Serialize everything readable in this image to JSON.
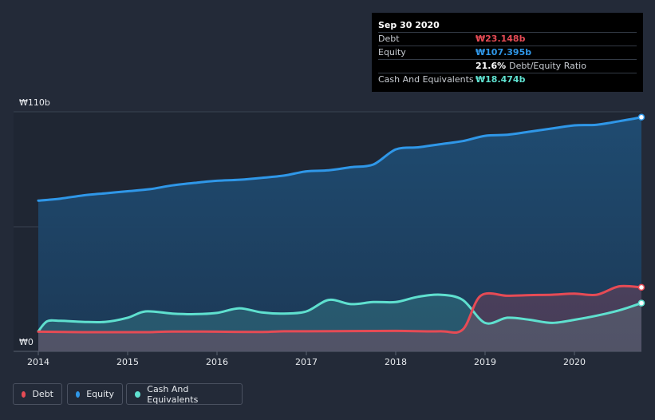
{
  "tooltip": {
    "date": "Sep 30 2020",
    "rows": [
      {
        "label": "Debt",
        "value": "₩23.148b",
        "color": "#e64b55"
      },
      {
        "label": "Equity",
        "value": "₩107.395b",
        "color": "#2f97e8"
      },
      {
        "label": "",
        "value": "21.6%",
        "sub": "Debt/Equity Ratio",
        "color": "#ffffff"
      },
      {
        "label": "Cash And Equivalents",
        "value": "₩18.474b",
        "color": "#5fe0cf"
      }
    ]
  },
  "legend": [
    {
      "label": "Debt",
      "color": "#e64b55"
    },
    {
      "label": "Equity",
      "color": "#2f97e8"
    },
    {
      "label": "Cash And Equivalents",
      "color": "#5fe0cf"
    }
  ],
  "chart_data": {
    "type": "area",
    "ylabel_top": "₩110b",
    "ylabel_bottom": "₩0",
    "ylim": [
      0,
      110
    ],
    "xlim": [
      2014.0,
      2020.75
    ],
    "x_ticks": [
      "2014",
      "2015",
      "2016",
      "2017",
      "2018",
      "2019",
      "2020"
    ],
    "series": [
      {
        "name": "Equity",
        "color": "#2f97e8",
        "points": [
          [
            2014.0,
            67.5
          ],
          [
            2014.25,
            68.5
          ],
          [
            2014.5,
            70.0
          ],
          [
            2014.75,
            71.0
          ],
          [
            2015.0,
            72.0
          ],
          [
            2015.25,
            73.0
          ],
          [
            2015.5,
            74.8
          ],
          [
            2015.75,
            76.0
          ],
          [
            2016.0,
            77.0
          ],
          [
            2016.25,
            77.5
          ],
          [
            2016.5,
            78.4
          ],
          [
            2016.75,
            79.5
          ],
          [
            2017.0,
            81.5
          ],
          [
            2017.25,
            82.0
          ],
          [
            2017.5,
            83.5
          ],
          [
            2017.75,
            84.8
          ],
          [
            2018.0,
            92.0
          ],
          [
            2018.25,
            93.0
          ],
          [
            2018.5,
            94.5
          ],
          [
            2018.75,
            96.0
          ],
          [
            2019.0,
            98.5
          ],
          [
            2019.25,
            99.0
          ],
          [
            2019.5,
            100.5
          ],
          [
            2019.75,
            102.0
          ],
          [
            2020.0,
            103.5
          ],
          [
            2020.25,
            103.8
          ],
          [
            2020.5,
            105.5
          ],
          [
            2020.75,
            107.4
          ]
        ]
      },
      {
        "name": "Cash And Equivalents",
        "color": "#5fe0cf",
        "points": [
          [
            2014.0,
            5.0
          ],
          [
            2014.1,
            9.8
          ],
          [
            2014.25,
            10.0
          ],
          [
            2014.5,
            9.5
          ],
          [
            2014.75,
            9.5
          ],
          [
            2015.0,
            11.5
          ],
          [
            2015.2,
            14.5
          ],
          [
            2015.5,
            13.5
          ],
          [
            2015.75,
            13.2
          ],
          [
            2016.0,
            13.8
          ],
          [
            2016.25,
            16.0
          ],
          [
            2016.5,
            14.0
          ],
          [
            2016.75,
            13.5
          ],
          [
            2017.0,
            14.5
          ],
          [
            2017.25,
            20.0
          ],
          [
            2017.5,
            18.0
          ],
          [
            2017.75,
            19.0
          ],
          [
            2018.0,
            19.0
          ],
          [
            2018.25,
            21.5
          ],
          [
            2018.5,
            22.5
          ],
          [
            2018.75,
            20.0
          ],
          [
            2019.0,
            9.0
          ],
          [
            2019.25,
            11.5
          ],
          [
            2019.5,
            10.5
          ],
          [
            2019.75,
            9.0
          ],
          [
            2020.0,
            10.5
          ],
          [
            2020.25,
            12.5
          ],
          [
            2020.5,
            15.0
          ],
          [
            2020.75,
            18.5
          ]
        ]
      },
      {
        "name": "Debt",
        "color": "#e64b55",
        "points": [
          [
            2014.0,
            4.8
          ],
          [
            2014.5,
            4.6
          ],
          [
            2015.0,
            4.6
          ],
          [
            2015.25,
            4.6
          ],
          [
            2015.5,
            4.9
          ],
          [
            2016.0,
            4.8
          ],
          [
            2016.5,
            4.7
          ],
          [
            2016.75,
            5.0
          ],
          [
            2017.0,
            5.0
          ],
          [
            2017.5,
            5.1
          ],
          [
            2018.0,
            5.2
          ],
          [
            2018.5,
            5.0
          ],
          [
            2018.75,
            5.8
          ],
          [
            2018.95,
            22.0
          ],
          [
            2019.25,
            22.0
          ],
          [
            2019.5,
            22.3
          ],
          [
            2019.75,
            22.5
          ],
          [
            2020.0,
            23.0
          ],
          [
            2020.25,
            22.5
          ],
          [
            2020.5,
            26.5
          ],
          [
            2020.75,
            26.0
          ]
        ]
      }
    ]
  }
}
